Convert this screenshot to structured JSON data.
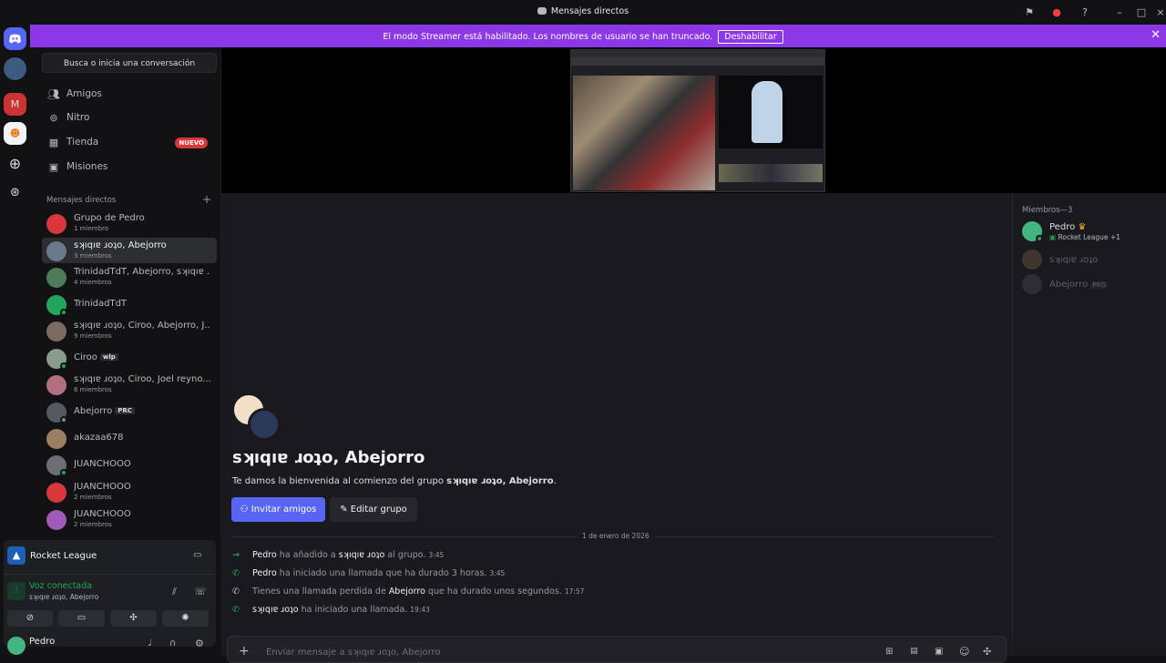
{
  "window": {
    "title": "Mensajes directos"
  },
  "banner": {
    "message": "El modo Streamer está habilitado. Los nombres de usuario se han truncado.",
    "button": "Deshabilitar"
  },
  "sidebar": {
    "search_label": "Busca o inicia una conversación",
    "nav": [
      {
        "label": "Amigos",
        "icon": "friends-icon"
      },
      {
        "label": "Nitro",
        "icon": "nitro-icon"
      },
      {
        "label": "Tienda",
        "icon": "shop-icon",
        "badge": "NUEVO"
      },
      {
        "label": "Misiones",
        "icon": "quests-icon"
      }
    ],
    "dm_header": "Mensajes directos",
    "dms": [
      {
        "name": "Grupo de Pedro",
        "sub": "1 miembro"
      },
      {
        "name": "sʞıqıɐ ɹoʇo, Abejorro",
        "sub": "3 miembros"
      },
      {
        "name": "TrinidadTdT, Abejorro, sʞıqıɐ ...",
        "sub": "4 miembros"
      },
      {
        "name": "TrinidadTdT",
        "sub": ""
      },
      {
        "name": "sʞıqıɐ ɹoʇo, Ciroo, Abejorro, J...",
        "sub": "9 miembros"
      },
      {
        "name": "Ciroo",
        "sub": "",
        "tag": "wlp"
      },
      {
        "name": "sʞıqıɐ ɹoʇo, Ciroo, Joel reyno...",
        "sub": "6 miembros"
      },
      {
        "name": "Abejorro",
        "sub": "",
        "tag": "PRC"
      },
      {
        "name": "akazaa678",
        "sub": ""
      },
      {
        "name": "JUANCHOOO",
        "sub": ""
      },
      {
        "name": "JUANCHOOO",
        "sub": "2 miembros"
      },
      {
        "name": "JUANCHOOO",
        "sub": "2 miembros"
      }
    ]
  },
  "activity": {
    "game": "Rocket League",
    "voice_status": "Voz conectada",
    "voice_channel": "sʞıqıɐ ɹoʇo, Abejorro",
    "user_name": "Pedro"
  },
  "members": {
    "header": "Miembros—3",
    "list": [
      {
        "name": "Pedro",
        "status": "Rocket League +1"
      },
      {
        "name": "sʞıqıɐ ɹoʇo",
        "status": ""
      },
      {
        "name": "Abejorro",
        "status": "",
        "tag": "PRG"
      }
    ]
  },
  "chat": {
    "group_title": "sʞıqıɐ ɹoʇo, Abejorro",
    "welcome_prefix": "Te damos la bienvenida al comienzo del grupo ",
    "welcome_group": "sʞıqıɐ ɹoʇo, Abejorro",
    "welcome_suffix": ".",
    "invite_button": "Invitar amigos",
    "edit_button": "Editar grupo",
    "date_divider": "1 de enero de 2026",
    "messages": [
      {
        "icon": "join-arrow-icon",
        "actor": "Pedro",
        "text1": " ha añadido a ",
        "target": "sʞıqıɐ ɹoʇo",
        "text2": " al grupo.",
        "time": "3:45"
      },
      {
        "icon": "phone-icon",
        "actor": "Pedro",
        "text1": " ha iniciado una llamada que ha durado 3 horas.",
        "target": "",
        "text2": "",
        "time": "3:45"
      },
      {
        "icon": "missed-call-icon",
        "actor": "",
        "text1": "Tienes una llamada perdida de ",
        "target": "Abejorro",
        "text2": " que ha durado unos segundos.",
        "time": "17:57"
      },
      {
        "icon": "phone-icon",
        "actor": "sʞıqıɐ ɹoʇo",
        "text1": " ha iniciado una llamada.",
        "target": "",
        "text2": "",
        "time": "19:43"
      }
    ],
    "input_placeholder": "Enviar mensaje a sʞıqıɐ ɹoʇo, Abejorro"
  },
  "colors": {
    "banner": "#8c38e8",
    "accent": "#5865f2",
    "online": "#23a55a",
    "badge_red": "#da373c"
  }
}
